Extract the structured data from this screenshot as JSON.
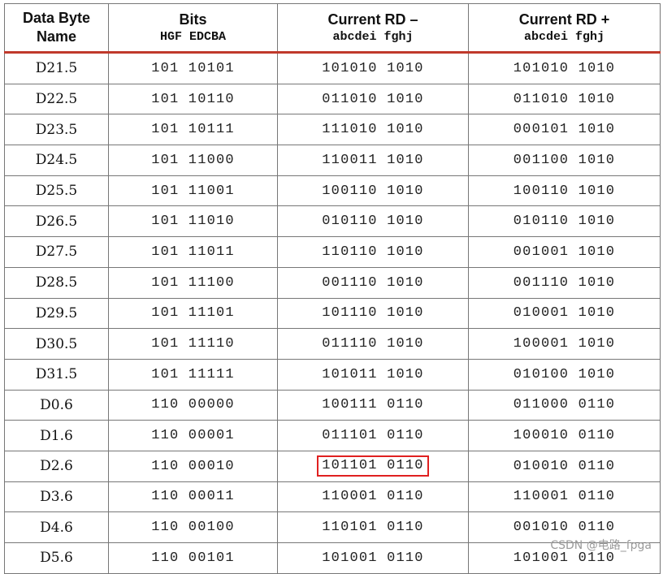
{
  "table": {
    "headers": [
      {
        "line1": "Data Byte",
        "line2": "Name"
      },
      {
        "line1": "Bits",
        "line2": "HGF EDCBA"
      },
      {
        "line1": "Current RD –",
        "line2": "abcdei fghj"
      },
      {
        "line1": "Current RD +",
        "line2": "abcdei fghj"
      }
    ],
    "rows": [
      {
        "name": "D21.5",
        "bits": "101 10101",
        "rd_minus": "101010 1010",
        "rd_plus": "101010 1010"
      },
      {
        "name": "D22.5",
        "bits": "101 10110",
        "rd_minus": "011010 1010",
        "rd_plus": "011010 1010"
      },
      {
        "name": "D23.5",
        "bits": "101 10111",
        "rd_minus": "111010 1010",
        "rd_plus": "000101 1010"
      },
      {
        "name": "D24.5",
        "bits": "101 11000",
        "rd_minus": "110011 1010",
        "rd_plus": "001100 1010"
      },
      {
        "name": "D25.5",
        "bits": "101 11001",
        "rd_minus": "100110 1010",
        "rd_plus": "100110 1010"
      },
      {
        "name": "D26.5",
        "bits": "101 11010",
        "rd_minus": "010110 1010",
        "rd_plus": "010110 1010"
      },
      {
        "name": "D27.5",
        "bits": "101 11011",
        "rd_minus": "110110 1010",
        "rd_plus": "001001 1010"
      },
      {
        "name": "D28.5",
        "bits": "101 11100",
        "rd_minus": "001110 1010",
        "rd_plus": "001110 1010"
      },
      {
        "name": "D29.5",
        "bits": "101 11101",
        "rd_minus": "101110 1010",
        "rd_plus": "010001 1010"
      },
      {
        "name": "D30.5",
        "bits": "101 11110",
        "rd_minus": "011110 1010",
        "rd_plus": "100001 1010"
      },
      {
        "name": "D31.5",
        "bits": "101 11111",
        "rd_minus": "101011 1010",
        "rd_plus": "010100 1010"
      },
      {
        "name": "D0.6",
        "bits": "110 00000",
        "rd_minus": "100111 0110",
        "rd_plus": "011000 0110"
      },
      {
        "name": "D1.6",
        "bits": "110 00001",
        "rd_minus": "011101 0110",
        "rd_plus": "100010 0110"
      },
      {
        "name": "D2.6",
        "bits": "110 00010",
        "rd_minus": "101101 0110",
        "rd_plus": "010010 0110"
      },
      {
        "name": "D3.6",
        "bits": "110 00011",
        "rd_minus": "110001 0110",
        "rd_plus": "110001 0110"
      },
      {
        "name": "D4.6",
        "bits": "110 00100",
        "rd_minus": "110101 0110",
        "rd_plus": "001010 0110"
      },
      {
        "name": "D5.6",
        "bits": "110 00101",
        "rd_minus": "101001 0110",
        "rd_plus": "101001 0110"
      }
    ]
  },
  "highlight": {
    "row_name": "D2.6",
    "column": "rd_minus",
    "color": "#e02020"
  },
  "watermark": "CSDN @电路_fpga",
  "colors": {
    "header_rule": "#c0392b",
    "grid": "#777777"
  }
}
